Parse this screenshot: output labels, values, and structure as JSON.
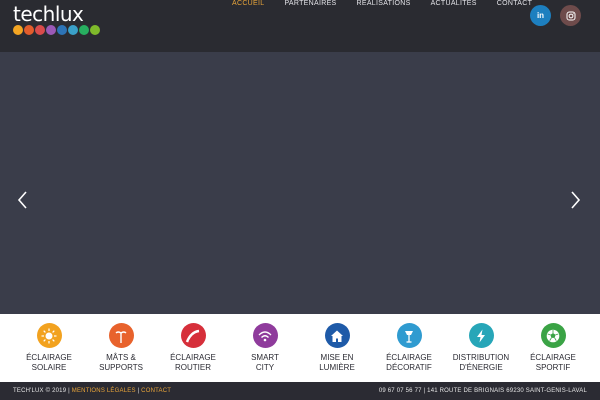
{
  "brand": {
    "name": "techlux",
    "dot_colors": [
      "#f4a623",
      "#e35d2c",
      "#d94b4b",
      "#9b59b6",
      "#2d74b7",
      "#3aa0c8",
      "#27ae60",
      "#7fba2b"
    ]
  },
  "nav": {
    "items": [
      {
        "label": "ACCUEIL",
        "active": true
      },
      {
        "label": "PARTENAIRES",
        "active": false
      },
      {
        "label": "RÉALISATIONS",
        "active": false
      },
      {
        "label": "ACTUALITÉS",
        "active": false
      },
      {
        "label": "CONTACT",
        "active": false
      }
    ]
  },
  "social": {
    "linkedin": "in",
    "instagram": "◎"
  },
  "slider": {
    "prev_icon": "chevron-left-icon",
    "next_icon": "chevron-right-icon"
  },
  "services": [
    {
      "label": "ÉCLAIRAGE\nSOLAIRE",
      "icon": "sun-icon",
      "color": "#f2a21f"
    },
    {
      "label": "MÂTS &\nSUPPORTS",
      "icon": "mast-icon",
      "color": "#e8622c"
    },
    {
      "label": "ÉCLAIRAGE\nROUTIER",
      "icon": "road-icon",
      "color": "#d62f3a"
    },
    {
      "label": "SMART\nCITY",
      "icon": "wifi-icon",
      "color": "#8f3b9c"
    },
    {
      "label": "MISE EN\nLUMIÈRE",
      "icon": "building-icon",
      "color": "#1e5aa8"
    },
    {
      "label": "ÉCLAIRAGE\nDÉCORATIF",
      "icon": "lamp-icon",
      "color": "#2f9bd0"
    },
    {
      "label": "DISTRIBUTION\nD'ÉNERGIE",
      "icon": "lightning-icon",
      "color": "#27a6b8"
    },
    {
      "label": "ÉCLAIRAGE\nSPORTIF",
      "icon": "football-icon",
      "color": "#3aa345"
    }
  ],
  "footer": {
    "copyright": "TECH'LUX © 2019 |",
    "legal_link": "MENTIONS LÉGALES",
    "separator": "|",
    "contact_link": "CONTACT",
    "address": "09 67 07 56 77 | 141 ROUTE DE BRIGNAIS 69230 SAINT-GENIS-LAVAL"
  }
}
